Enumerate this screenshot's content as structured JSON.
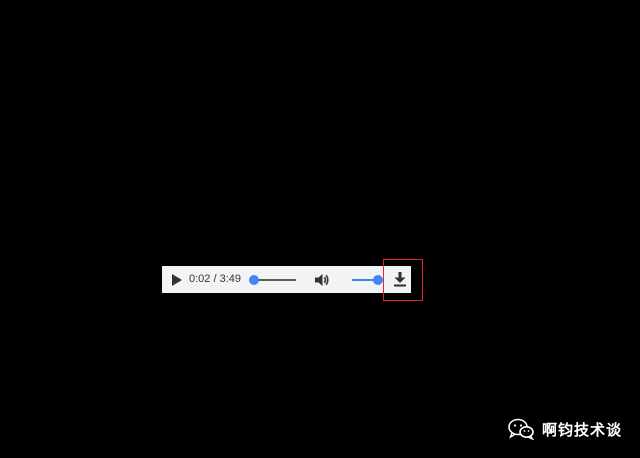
{
  "player": {
    "play_icon": "play-icon",
    "current_time": "0:02",
    "separator": " / ",
    "duration": "3:49",
    "progress_fraction": 0.01,
    "volume_icon": "volume-icon",
    "volume_fraction": 1.0,
    "download_icon": "download-icon",
    "accent_color": "#4285f4",
    "background_color": "#f1f3f4"
  },
  "highlight": {
    "color": "#e0262f"
  },
  "watermark": {
    "logo_icon": "wechat-icon",
    "text": "啊钧技术谈"
  }
}
